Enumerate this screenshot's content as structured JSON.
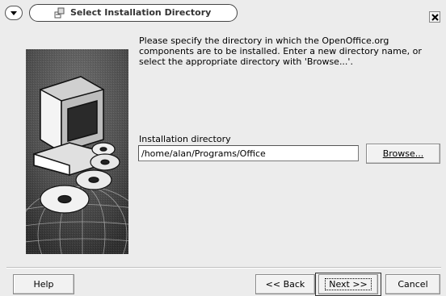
{
  "window": {
    "title": "Select Installation Directory"
  },
  "content": {
    "description": "Please specify the directory in which the OpenOffice.org components are to be installed. Enter a new directory name, or select the appropriate directory with 'Browse...'.",
    "directory_label": "Installation directory",
    "directory_value": "/home/alan/Programs/Office",
    "browse_label": "Browse..."
  },
  "buttons": {
    "help": "Help",
    "back": "<< Back",
    "next": "Next >>",
    "cancel": "Cancel"
  },
  "icons": {
    "window_menu": "chevron-down-icon",
    "title": "installer-icon",
    "close": "close-icon",
    "illustration": "computer-and-discs-illustration"
  }
}
